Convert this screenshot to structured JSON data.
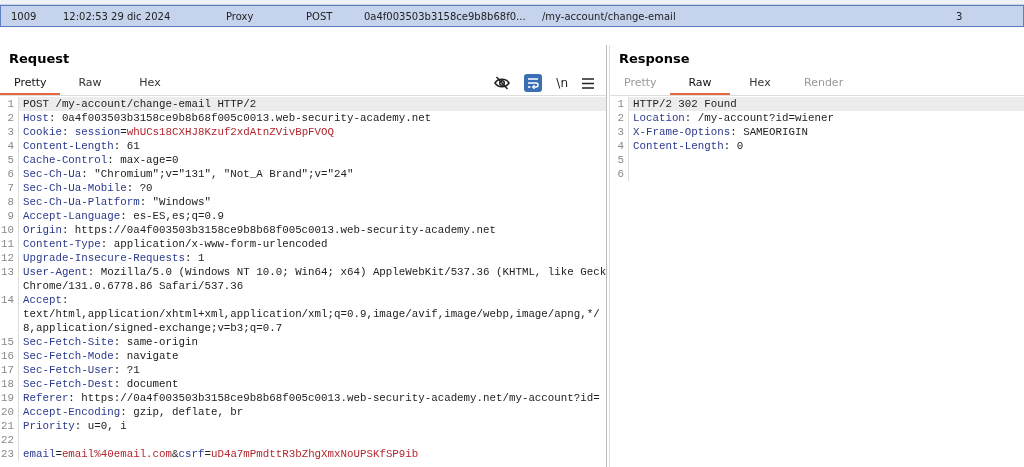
{
  "history_row": {
    "selected": true,
    "cells": [
      "1009",
      "12:02:53 29 dic 2024",
      "Proxy",
      "POST",
      "0a4f003503b3158ce9b8b68f0...",
      "/my-account/change-email",
      "3"
    ]
  },
  "request": {
    "title": "Request",
    "tabs": [
      {
        "label": "Pretty",
        "selected": true,
        "disabled": false
      },
      {
        "label": "Raw",
        "selected": false,
        "disabled": false
      },
      {
        "label": "Hex",
        "selected": false,
        "disabled": false
      }
    ],
    "toolbar": {
      "wrap_on": true,
      "newline_label": "\\n"
    },
    "lines": [
      {
        "number": "1",
        "highlighted": true,
        "parts": [
          {
            "kind": "text",
            "text": "POST /my-account/change-email HTTP/2"
          }
        ]
      },
      {
        "number": "2",
        "highlighted": false,
        "parts": [
          {
            "kind": "name",
            "text": "Host"
          },
          {
            "kind": "text",
            "text": ": 0a4f003503b3158ce9b8b68f005c0013.web-security-academy.net"
          }
        ]
      },
      {
        "number": "3",
        "highlighted": false,
        "parts": [
          {
            "kind": "name",
            "text": "Cookie"
          },
          {
            "kind": "text",
            "text": ": "
          },
          {
            "kind": "param",
            "text": "session"
          },
          {
            "kind": "text",
            "text": "="
          },
          {
            "kind": "value",
            "text": "whUCs18CXHJ8Kzuf2xdAtnZVivBpFVOQ"
          }
        ]
      },
      {
        "number": "4",
        "highlighted": false,
        "parts": [
          {
            "kind": "name",
            "text": "Content-Length"
          },
          {
            "kind": "text",
            "text": ": 61"
          }
        ]
      },
      {
        "number": "5",
        "highlighted": false,
        "parts": [
          {
            "kind": "name",
            "text": "Cache-Control"
          },
          {
            "kind": "text",
            "text": ": max-age=0"
          }
        ]
      },
      {
        "number": "6",
        "highlighted": false,
        "parts": [
          {
            "kind": "name",
            "text": "Sec-Ch-Ua"
          },
          {
            "kind": "text",
            "text": ": \"Chromium\";v=\"131\", \"Not_A Brand\";v=\"24\""
          }
        ]
      },
      {
        "number": "7",
        "highlighted": false,
        "parts": [
          {
            "kind": "name",
            "text": "Sec-Ch-Ua-Mobile"
          },
          {
            "kind": "text",
            "text": ": ?0"
          }
        ]
      },
      {
        "number": "8",
        "highlighted": false,
        "parts": [
          {
            "kind": "name",
            "text": "Sec-Ch-Ua-Platform"
          },
          {
            "kind": "text",
            "text": ": \"Windows\""
          }
        ]
      },
      {
        "number": "9",
        "highlighted": false,
        "parts": [
          {
            "kind": "name",
            "text": "Accept-Language"
          },
          {
            "kind": "text",
            "text": ": es-ES,es;q=0.9"
          }
        ]
      },
      {
        "number": "10",
        "highlighted": false,
        "parts": [
          {
            "kind": "name",
            "text": "Origin"
          },
          {
            "kind": "text",
            "text": ": https://0a4f003503b3158ce9b8b68f005c0013.web-security-academy.net"
          }
        ]
      },
      {
        "number": "11",
        "highlighted": false,
        "parts": [
          {
            "kind": "name",
            "text": "Content-Type"
          },
          {
            "kind": "text",
            "text": ": application/x-www-form-urlencoded"
          }
        ]
      },
      {
        "number": "12",
        "highlighted": false,
        "parts": [
          {
            "kind": "name",
            "text": "Upgrade-Insecure-Requests"
          },
          {
            "kind": "text",
            "text": ": 1"
          }
        ]
      },
      {
        "number": "13",
        "highlighted": false,
        "parts": [
          {
            "kind": "name",
            "text": "User-Agent"
          },
          {
            "kind": "text",
            "text": ": Mozilla/5.0 (Windows NT 10.0; Win64; x64) AppleWebKit/537.36 (KHTML, like Geck"
          }
        ],
        "continued": [
          "Chrome/131.0.6778.86 Safari/537.36"
        ]
      },
      {
        "number": "14",
        "highlighted": false,
        "parts": [
          {
            "kind": "name",
            "text": "Accept"
          },
          {
            "kind": "text",
            "text": ":"
          }
        ],
        "continued": [
          "text/html,application/xhtml+xml,application/xml;q=0.9,image/avif,image/webp,image/apng,*/",
          "8,application/signed-exchange;v=b3;q=0.7"
        ]
      },
      {
        "number": "15",
        "highlighted": false,
        "parts": [
          {
            "kind": "name",
            "text": "Sec-Fetch-Site"
          },
          {
            "kind": "text",
            "text": ": same-origin"
          }
        ]
      },
      {
        "number": "16",
        "highlighted": false,
        "parts": [
          {
            "kind": "name",
            "text": "Sec-Fetch-Mode"
          },
          {
            "kind": "text",
            "text": ": navigate"
          }
        ]
      },
      {
        "number": "17",
        "highlighted": false,
        "parts": [
          {
            "kind": "name",
            "text": "Sec-Fetch-User"
          },
          {
            "kind": "text",
            "text": ": ?1"
          }
        ]
      },
      {
        "number": "18",
        "highlighted": false,
        "parts": [
          {
            "kind": "name",
            "text": "Sec-Fetch-Dest"
          },
          {
            "kind": "text",
            "text": ": document"
          }
        ]
      },
      {
        "number": "19",
        "highlighted": false,
        "parts": [
          {
            "kind": "name",
            "text": "Referer"
          },
          {
            "kind": "text",
            "text": ": https://0a4f003503b3158ce9b8b68f005c0013.web-security-academy.net/my-account?id="
          }
        ]
      },
      {
        "number": "20",
        "highlighted": false,
        "parts": [
          {
            "kind": "name",
            "text": "Accept-Encoding"
          },
          {
            "kind": "text",
            "text": ": gzip, deflate, br"
          }
        ]
      },
      {
        "number": "21",
        "highlighted": false,
        "parts": [
          {
            "kind": "name",
            "text": "Priority"
          },
          {
            "kind": "text",
            "text": ": u=0, i"
          }
        ]
      },
      {
        "number": "22",
        "highlighted": false
      },
      {
        "number": "23",
        "highlighted": false,
        "parts": [
          {
            "kind": "param",
            "text": "email"
          },
          {
            "kind": "text",
            "text": "="
          },
          {
            "kind": "value",
            "text": "email%40email.com"
          },
          {
            "kind": "text",
            "text": "&"
          },
          {
            "kind": "param",
            "text": "csrf"
          },
          {
            "kind": "text",
            "text": "="
          },
          {
            "kind": "value",
            "text": "uD4a7mPmdttR3bZhgXmxNoUPSKfSP9ib"
          }
        ]
      }
    ]
  },
  "response": {
    "title": "Response",
    "tabs": [
      {
        "label": "Pretty",
        "selected": false,
        "disabled": true
      },
      {
        "label": "Raw",
        "selected": true,
        "disabled": false
      },
      {
        "label": "Hex",
        "selected": false,
        "disabled": false
      },
      {
        "label": "Render",
        "selected": false,
        "disabled": true
      }
    ],
    "lines": [
      {
        "number": "1",
        "highlighted": true,
        "parts": [
          {
            "kind": "text",
            "text": "HTTP/2 302 Found"
          }
        ]
      },
      {
        "number": "2",
        "highlighted": false,
        "parts": [
          {
            "kind": "name",
            "text": "Location"
          },
          {
            "kind": "text",
            "text": ": /my-account?id=wiener"
          }
        ]
      },
      {
        "number": "3",
        "highlighted": false,
        "parts": [
          {
            "kind": "name",
            "text": "X-Frame-Options"
          },
          {
            "kind": "text",
            "text": ": SAMEORIGIN"
          }
        ]
      },
      {
        "number": "4",
        "highlighted": false,
        "parts": [
          {
            "kind": "name",
            "text": "Content-Length"
          },
          {
            "kind": "text",
            "text": ": 0"
          }
        ]
      },
      {
        "number": "5",
        "highlighted": false
      },
      {
        "number": "6",
        "highlighted": false
      }
    ]
  }
}
